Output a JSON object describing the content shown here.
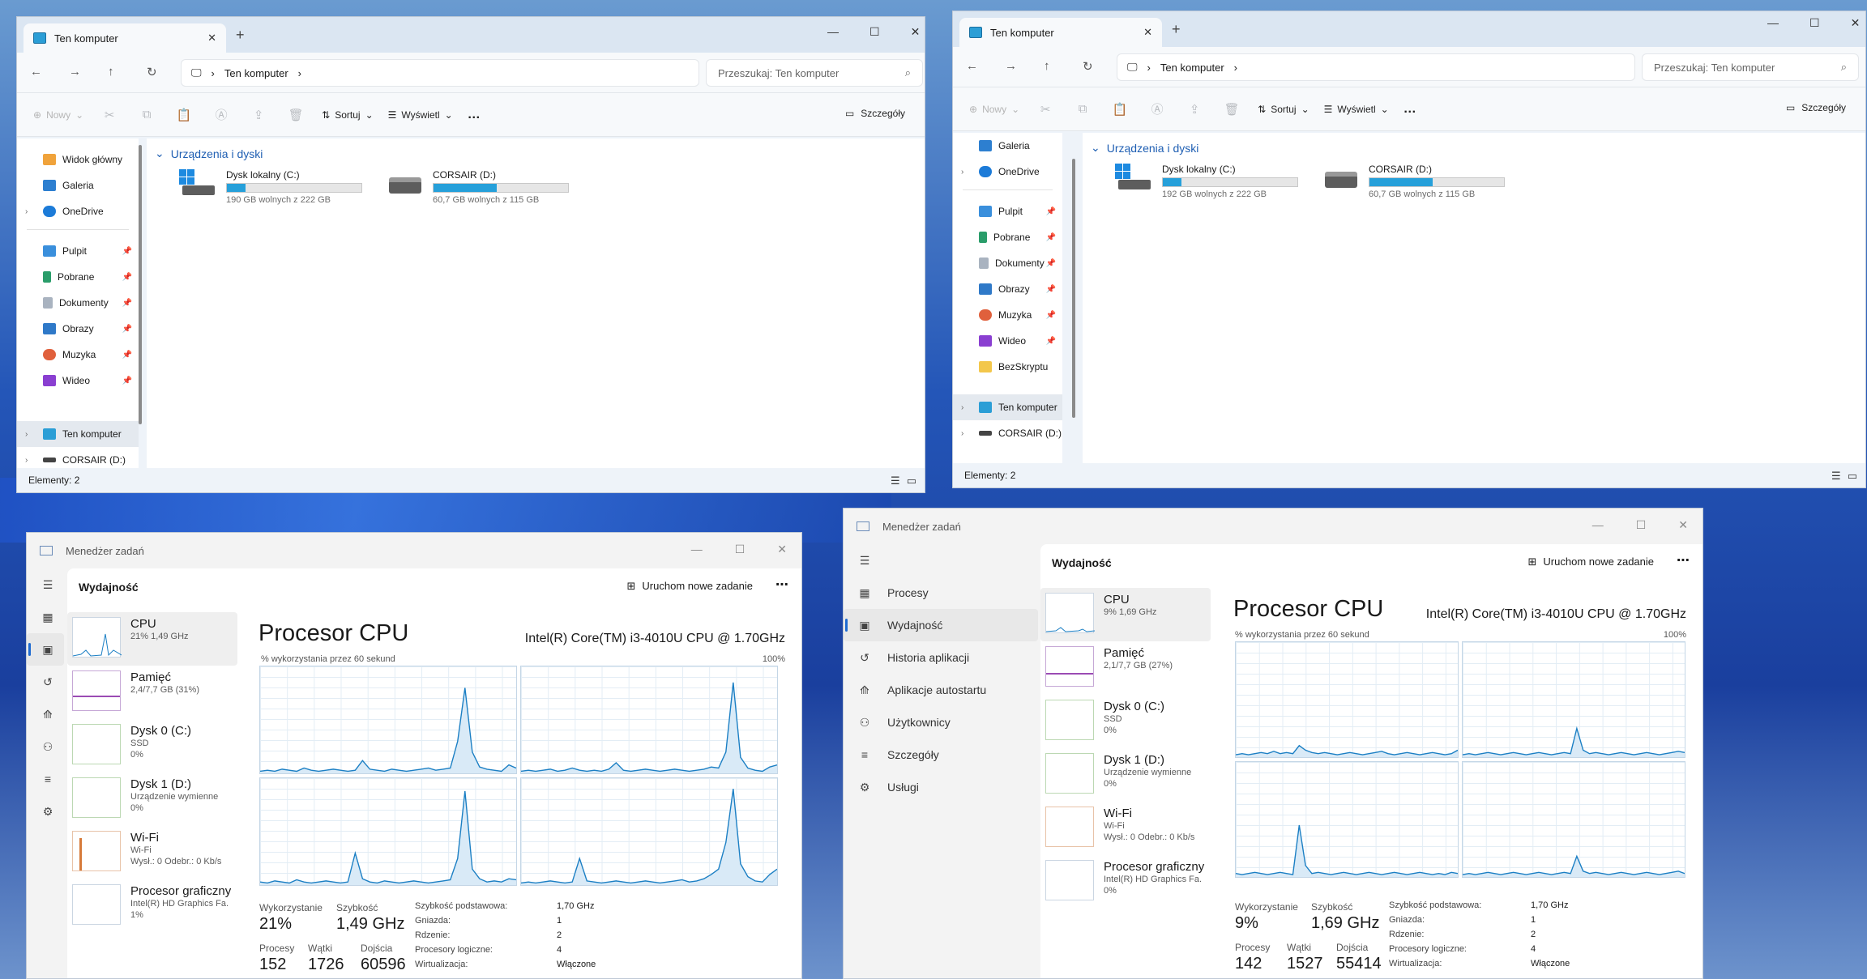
{
  "explorer": {
    "tab_title": "Ten komputer",
    "address": "Ten komputer",
    "search_placeholder": "Przeszukaj: Ten komputer",
    "toolbar": {
      "new": "Nowy",
      "sort": "Sortuj",
      "view": "Wyświetl",
      "more": "…",
      "details": "Szczegóły"
    },
    "group": "Urządzenia i dyski",
    "status": "Elementy: 2",
    "sidebar_left": {
      "top": [
        "Widok główny",
        "Galeria",
        "OneDrive"
      ],
      "pinned": [
        "Pulpit",
        "Pobrane",
        "Dokumenty",
        "Obrazy",
        "Muzyka",
        "Wideo"
      ],
      "bottom": [
        "Ten komputer",
        "CORSAIR (D:)"
      ]
    },
    "sidebar_right": {
      "top": [
        "Galeria",
        "OneDrive"
      ],
      "pinned": [
        "Pulpit",
        "Pobrane",
        "Dokumenty",
        "Obrazy",
        "Muzyka",
        "Wideo",
        "BezSkryptu"
      ],
      "bottom": [
        "Ten komputer",
        "CORSAIR (D:)"
      ]
    },
    "drives_left": [
      {
        "name": "Dysk lokalny (C:)",
        "free": "190 GB wolnych z 222 GB",
        "used_fraction": 0.14
      },
      {
        "name": "CORSAIR (D:)",
        "free": "60,7 GB wolnych z 115 GB",
        "used_fraction": 0.47
      }
    ],
    "drives_right": [
      {
        "name": "Dysk lokalny (C:)",
        "free": "192 GB wolnych z 222 GB",
        "used_fraction": 0.14
      },
      {
        "name": "CORSAIR (D:)",
        "free": "60,7 GB wolnych z 115 GB",
        "used_fraction": 0.47
      }
    ]
  },
  "taskmgr": {
    "title": "Menedżer zadań",
    "section": "Wydajność",
    "new_task": "Uruchom nowe zadanie",
    "nav": [
      "Procesy",
      "Wydajność",
      "Historia aplikacji",
      "Aplikacje autostartu",
      "Użytkownicy",
      "Szczegóły",
      "Usługi"
    ],
    "cpu_title": "Procesor CPU",
    "cpu_model": "Intel(R) Core(TM) i3-4010U CPU @ 1.70GHz",
    "graph_label": "% wykorzystania przez 60 sekund",
    "graph_max": "100%",
    "labels": {
      "util": "Wykorzystanie",
      "speed": "Szybkość",
      "procs": "Procesy",
      "threads": "Wątki",
      "handles": "Dojścia"
    },
    "kv_keys": [
      "Szybkość podstawowa:",
      "Gniazda:",
      "Rdzenie:",
      "Procesory logiczne:",
      "Wirtualizacja:"
    ],
    "left": {
      "resources": [
        {
          "name": "CPU",
          "s1": "21% 1,49 GHz",
          "s2": "",
          "s3": ""
        },
        {
          "name": "Pamięć",
          "s1": "2,4/7,7 GB (31%)",
          "s2": "",
          "s3": ""
        },
        {
          "name": "Dysk 0 (C:)",
          "s1": "SSD",
          "s2": "0%",
          "s3": ""
        },
        {
          "name": "Dysk 1 (D:)",
          "s1": "Urządzenie wymienne",
          "s2": "0%",
          "s3": ""
        },
        {
          "name": "Wi-Fi",
          "s1": "Wi-Fi",
          "s2": "Wysł.: 0 Odebr.: 0 Kb/s",
          "s3": ""
        },
        {
          "name": "Procesor graficzny",
          "s1": "Intel(R) HD Graphics Fa.",
          "s2": "1%",
          "s3": ""
        }
      ],
      "util": "21%",
      "speed": "1,49 GHz",
      "procs": "152",
      "threads": "1726",
      "handles": "60596",
      "kv_vals": [
        "1,70 GHz",
        "1",
        "2",
        "4",
        "Włączone"
      ],
      "cpu_util_series": [
        [
          2,
          3,
          2,
          4,
          3,
          2,
          5,
          3,
          2,
          3,
          4,
          3,
          2,
          3,
          12,
          4,
          3,
          2,
          4,
          3,
          2,
          3,
          4,
          5,
          3,
          4,
          5,
          30,
          80,
          20,
          6,
          4,
          3,
          2,
          8,
          5
        ],
        [
          2,
          3,
          2,
          3,
          4,
          2,
          3,
          5,
          3,
          2,
          3,
          2,
          4,
          10,
          3,
          2,
          3,
          4,
          3,
          2,
          3,
          4,
          3,
          2,
          3,
          4,
          6,
          5,
          20,
          85,
          15,
          5,
          3,
          2,
          6,
          8
        ],
        [
          3,
          2,
          4,
          3,
          2,
          5,
          3,
          2,
          3,
          4,
          3,
          2,
          3,
          30,
          6,
          3,
          2,
          4,
          3,
          2,
          3,
          4,
          3,
          2,
          3,
          4,
          5,
          25,
          88,
          15,
          6,
          3,
          4,
          3,
          6,
          5
        ],
        [
          2,
          3,
          2,
          3,
          4,
          3,
          2,
          3,
          25,
          4,
          3,
          2,
          3,
          4,
          3,
          2,
          3,
          4,
          3,
          2,
          3,
          4,
          5,
          3,
          4,
          6,
          10,
          15,
          40,
          90,
          20,
          8,
          4,
          3,
          10,
          15
        ]
      ]
    },
    "right": {
      "resources": [
        {
          "name": "CPU",
          "s1": "9% 1,69 GHz",
          "s2": "",
          "s3": ""
        },
        {
          "name": "Pamięć",
          "s1": "2,1/7,7 GB (27%)",
          "s2": "",
          "s3": ""
        },
        {
          "name": "Dysk 0 (C:)",
          "s1": "SSD",
          "s2": "0%",
          "s3": ""
        },
        {
          "name": "Dysk 1 (D:)",
          "s1": "Urządzenie wymienne",
          "s2": "0%",
          "s3": ""
        },
        {
          "name": "Wi-Fi",
          "s1": "Wi-Fi",
          "s2": "Wysł.: 0 Odebr.: 0 Kb/s",
          "s3": ""
        },
        {
          "name": "Procesor graficzny",
          "s1": "Intel(R) HD Graphics Fa.",
          "s2": "0%",
          "s3": ""
        }
      ],
      "util": "9%",
      "speed": "1,69 GHz",
      "procs": "142",
      "threads": "1527",
      "handles": "55414",
      "kv_vals": [
        "1,70 GHz",
        "1",
        "2",
        "4",
        "Włączone"
      ],
      "cpu_util_series": [
        [
          2,
          3,
          2,
          3,
          4,
          3,
          5,
          3,
          4,
          3,
          10,
          6,
          4,
          3,
          4,
          3,
          2,
          3,
          4,
          3,
          2,
          3,
          4,
          5,
          3,
          2,
          3,
          4,
          3,
          2,
          3,
          4,
          3,
          2,
          3,
          6
        ],
        [
          2,
          3,
          2,
          3,
          4,
          3,
          2,
          3,
          4,
          3,
          2,
          3,
          4,
          3,
          2,
          3,
          4,
          3,
          25,
          6,
          3,
          4,
          3,
          2,
          3,
          4,
          3,
          2,
          3,
          4,
          3,
          2,
          3,
          4,
          5,
          4
        ],
        [
          3,
          2,
          3,
          4,
          3,
          2,
          3,
          4,
          3,
          2,
          45,
          10,
          3,
          4,
          3,
          2,
          3,
          4,
          3,
          2,
          3,
          4,
          3,
          2,
          3,
          4,
          3,
          2,
          3,
          4,
          3,
          2,
          3,
          2,
          4,
          3
        ],
        [
          2,
          3,
          2,
          3,
          4,
          3,
          2,
          3,
          4,
          3,
          2,
          3,
          4,
          3,
          2,
          3,
          4,
          3,
          18,
          5,
          3,
          4,
          3,
          2,
          3,
          4,
          3,
          2,
          3,
          4,
          3,
          2,
          3,
          4,
          5,
          3
        ]
      ]
    }
  }
}
